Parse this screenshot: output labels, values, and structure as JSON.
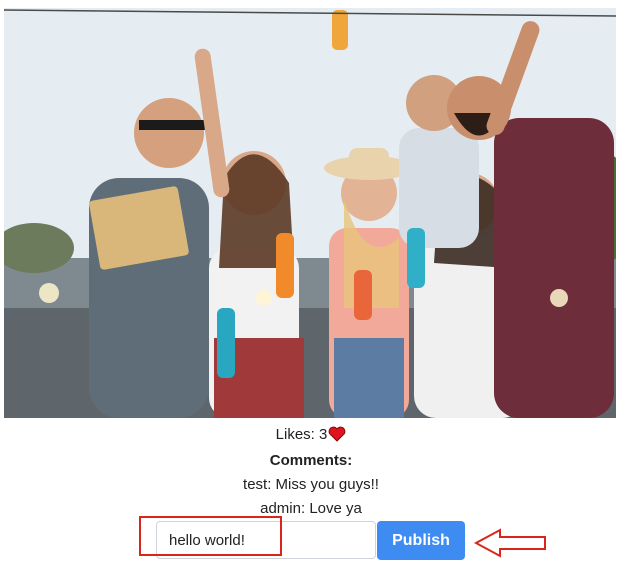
{
  "post": {
    "image_alt": "group of friends celebrating with drinks",
    "likes_label": "Likes: 3",
    "heart_color": "#e0141e",
    "comments_heading": "Comments:",
    "comments": [
      {
        "text": "test: Miss you guys!!"
      },
      {
        "text": "admin: Love ya"
      }
    ]
  },
  "comment_form": {
    "input_value": "hello world!",
    "publish_label": "Publish",
    "publish_color": "#3e8bf2"
  },
  "annotation": {
    "highlight_color": "#d9261c",
    "arrow_direction": "left"
  }
}
